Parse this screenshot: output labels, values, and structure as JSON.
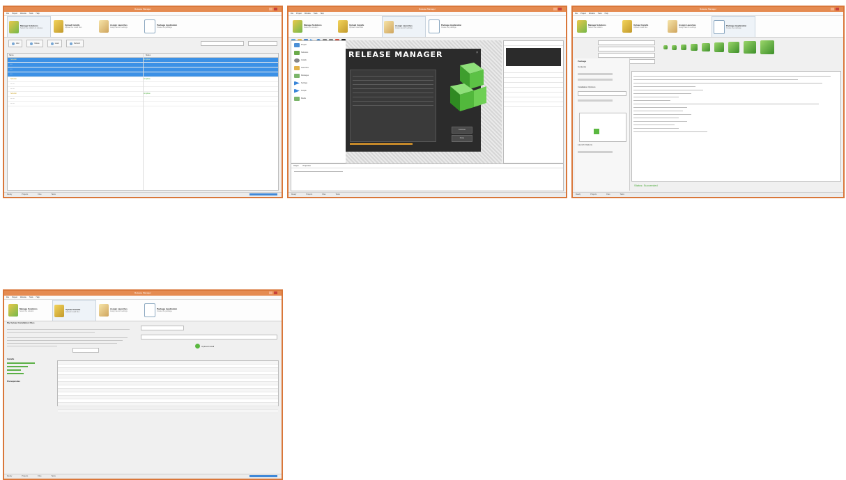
{
  "screenshots": [
    {
      "window_title": "Release Manager",
      "menu": [
        "File",
        "Project",
        "Window",
        "Tools",
        "Help"
      ],
      "steps": [
        {
          "title": "Manage Solutions",
          "sub": "Select the solution to release"
        },
        {
          "title": "Upload Installs",
          "sub": "Upload the install files"
        },
        {
          "title": "Assign Launches",
          "sub": "Assign launch settings"
        },
        {
          "title": "Package Application",
          "sub": "Create the package"
        }
      ],
      "toolbar": [
        "Add",
        "Delete",
        "Load",
        "Refresh"
      ],
      "columns": [
        "Name",
        "Status"
      ],
      "rows": [
        {
          "name": "Solution",
          "status": "Complete"
        },
        {
          "name": "Solution",
          "status": "Complete"
        },
        {
          "name": "Solution",
          "status": "Complete"
        }
      ],
      "status": [
        "Ready",
        "Projects",
        "Files",
        "Tasks"
      ]
    },
    {
      "window_title": "Release Manager",
      "menu": [
        "File",
        "Project",
        "Window",
        "Tools",
        "Help"
      ],
      "steps": [
        {
          "title": "Manage Solutions",
          "sub": "Select the solution"
        },
        {
          "title": "Upload Installs",
          "sub": "Upload install files"
        },
        {
          "title": "Assign Launches",
          "sub": "Assign launch settings"
        },
        {
          "title": "Package Application",
          "sub": "Create the package"
        }
      ],
      "tree": [
        "Project",
        "Solutions",
        "Installs",
        "Launches",
        "Packages",
        "Settings",
        "Scripts",
        "Media"
      ],
      "splash_title": "RELEASE MANAGER",
      "splash_buttons": [
        "Continue",
        "Close"
      ],
      "bottom_tabs": [
        "Output",
        "Properties"
      ],
      "status": [
        "Ready",
        "Projects",
        "Files",
        "Tasks"
      ]
    },
    {
      "window_title": "Release Manager",
      "menu": [
        "File",
        "Project",
        "Window",
        "Tools",
        "Help"
      ],
      "steps": [
        {
          "title": "Manage Solutions",
          "sub": "Select the solution"
        },
        {
          "title": "Upload Installs",
          "sub": "Upload install files"
        },
        {
          "title": "Assign Launches",
          "sub": "Assign launch settings"
        },
        {
          "title": "Package Application",
          "sub": "Create the package"
        }
      ],
      "left_sections": [
        "Package",
        "Contents",
        "Installation Options",
        "Launch Options"
      ],
      "done_text": "Status: Succeeded",
      "status": [
        "Ready",
        "Projects",
        "Files",
        "Tasks"
      ]
    },
    {
      "window_title": "Release Manager",
      "menu": [
        "File",
        "Project",
        "Window",
        "Tools",
        "Help"
      ],
      "steps": [
        {
          "title": "Manage Solutions",
          "sub": "Select the solution"
        },
        {
          "title": "Upload Installs",
          "sub": "Upload install files"
        },
        {
          "title": "Assign Launches",
          "sub": "Assign launch settings"
        },
        {
          "title": "Package Application",
          "sub": "Create the package"
        }
      ],
      "panel_heading": "My Upload Installation Files",
      "nav_label_1": "Installs",
      "nav_label_2": "Prerequisites",
      "upload_button": "Upload Install",
      "status": [
        "Ready",
        "Projects",
        "Files",
        "Tasks"
      ]
    }
  ]
}
